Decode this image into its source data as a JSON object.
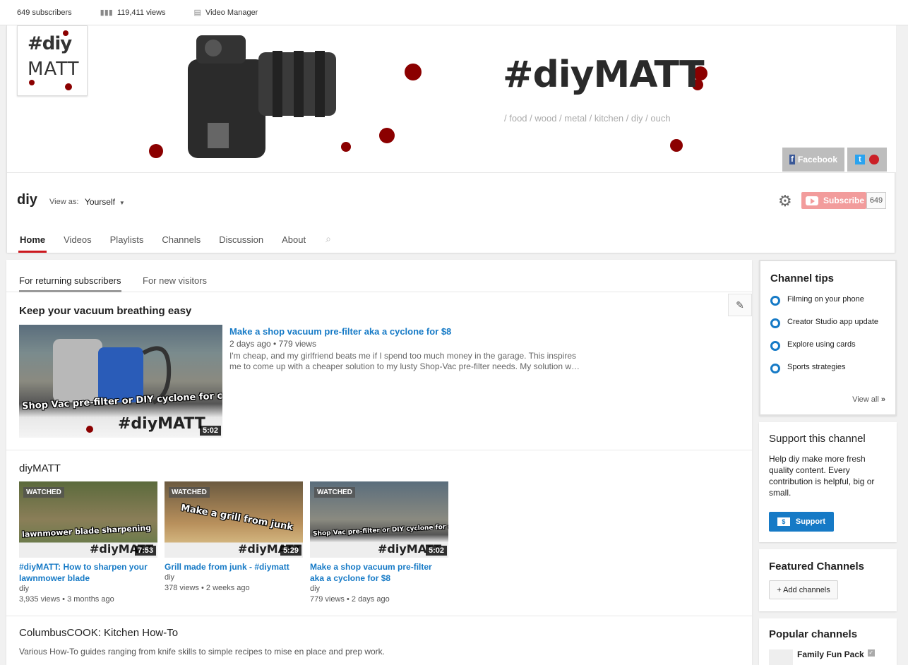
{
  "stats": {
    "subscribers": "649 subscribers",
    "views": "119,411 views",
    "video_manager": "Video Manager"
  },
  "banner": {
    "avatar_line1": "#diy",
    "avatar_line2": "MATT",
    "logo": "#diyMATT",
    "tagline": "/ food / wood / metal / kitchen / diy / ouch",
    "facebook_label": "Facebook",
    "accent_color": "#8b0000"
  },
  "channel": {
    "name": "diy",
    "view_as_label": "View as:",
    "view_as_value": "Yourself",
    "subscribe_label": "Subscribe",
    "subscriber_count": "649"
  },
  "tabs": [
    "Home",
    "Videos",
    "Playlists",
    "Channels",
    "Discussion",
    "About"
  ],
  "subtabs": [
    "For returning subscribers",
    "For new visitors"
  ],
  "featured": {
    "section_title": "Keep your vacuum breathing easy",
    "thumb_caption": "Shop Vac pre-filter or DIY cyclone for cheap",
    "thumb_logo": "#diyMATT",
    "duration": "5:02",
    "title": "Make a shop vacuum pre-filter aka a cyclone for $8",
    "age": "2 days ago",
    "views": "779 views",
    "description": "I'm cheap, and my girlfriend beats me if I spend too much money in the garage. This inspires me to come up with a cheaper solution to my lusty Shop-Vac pre-filter needs. My solution w…"
  },
  "shelf": {
    "title": "diyMATT",
    "videos": [
      {
        "badge": "WATCHED",
        "caption": "lawnmower blade sharpening",
        "logo": "#diyMATT",
        "duration": "7:53",
        "title": "#diyMATT: How to sharpen your lawnmower blade",
        "channel": "diy",
        "views": "3,935 views",
        "age": "3 months ago"
      },
      {
        "badge": "WATCHED",
        "caption": "Make a grill from junk",
        "logo": "#diyMATT",
        "duration": "5:29",
        "title": "Grill made from junk - #diymatt",
        "channel": "diy",
        "views": "378 views",
        "age": "2 weeks ago"
      },
      {
        "badge": "WATCHED",
        "caption": "Shop Vac pre-filter or DIY cyclone for cheap",
        "logo": "#diyMATT",
        "duration": "5:02",
        "title": "Make a shop vacuum pre-filter aka a cyclone for $8",
        "channel": "diy",
        "views": "779 views",
        "age": "2 days ago"
      }
    ]
  },
  "section3": {
    "title": "ColumbusCOOK: Kitchen How-To",
    "description": "Various How-To guides ranging from knife skills to simple recipes to mise en place and prep work."
  },
  "sidebar": {
    "tips_title": "Channel tips",
    "tips": [
      "Filming on your phone",
      "Creator Studio app update",
      "Explore using cards",
      "Sports strategies"
    ],
    "view_all": "View all",
    "support_title": "Support this channel",
    "support_text": "Help diy make more fresh quality content. Every contribution is helpful, big or small.",
    "support_button": "Support",
    "featured_title": "Featured Channels",
    "add_channels": "+ Add channels",
    "popular_title": "Popular channels",
    "popular_first": "Family Fun Pack"
  }
}
